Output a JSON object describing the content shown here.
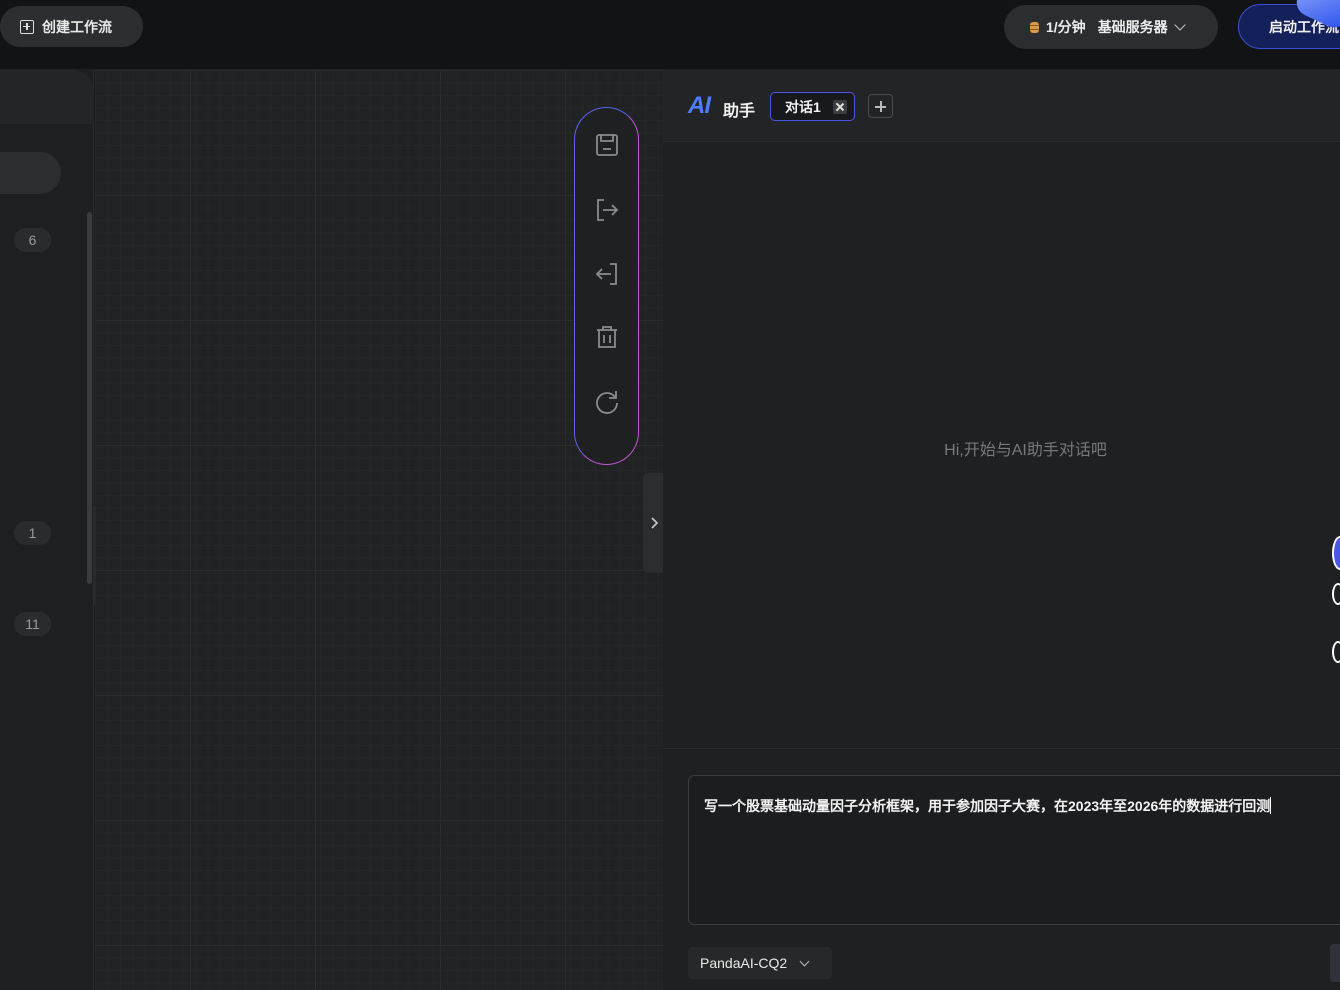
{
  "topbar": {
    "create_workflow": "创建工作流",
    "rate": "1/分钟",
    "server": "基础服务器",
    "start_workflow": "启动工作流"
  },
  "left_panel": {
    "counts": [
      "6",
      "1",
      "11"
    ]
  },
  "canvas_toolbar": {
    "tools": [
      "save-icon",
      "export-icon",
      "import-icon",
      "trash-icon",
      "refresh-icon"
    ]
  },
  "ai_panel": {
    "logo": "AI",
    "title": "助手",
    "tabs": [
      {
        "label": "对话1"
      }
    ],
    "empty_hint": "Hi,开始与AI助手对话吧",
    "prompt_value": "写一个股票基础动量因子分析框架，用于参加因子大赛，在2023年至2026年的数据进行回测",
    "model": "PandaAI-CQ2"
  },
  "colors": {
    "accent": "#4f7bff",
    "toolbar_gradient_start": "#5a64f0",
    "toolbar_gradient_end": "#c455d6",
    "start_button_bg": "#14205a"
  }
}
